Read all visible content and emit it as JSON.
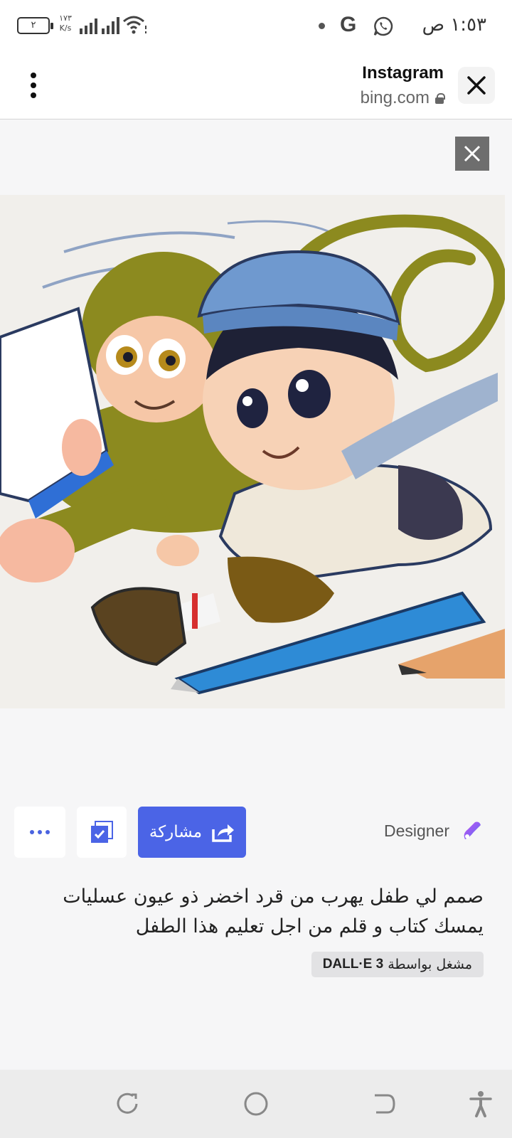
{
  "status_bar": {
    "time": "١:٥٣ ص",
    "battery_text": "٢",
    "net_speed_value": "١٧٣",
    "net_speed_unit": "K/s",
    "icons": [
      "battery-icon",
      "signal-icon",
      "wifi-icon",
      "notification-dot-icon",
      "google-icon",
      "whatsapp-icon"
    ]
  },
  "browser": {
    "title": "Instagram",
    "url": "bing.com",
    "icons": {
      "close": "close-icon",
      "menu": "more-vert-icon",
      "lock": "lock-icon"
    }
  },
  "viewer": {
    "close_icon": "close-icon",
    "image_alt": "monkey-and-child-illustration",
    "actions": {
      "share_label": "مشاركة",
      "share_icon": "share-icon",
      "save_icon": "save-collection-icon",
      "more_icon": "more-horizontal-icon"
    },
    "designer_label": "Designer",
    "designer_icon": "designer-logo-icon",
    "prompt": "صمم لي طفل يهرب من قرد اخضر ذو عيون عسليات يمسك كتاب و قلم من اجل تعليم هذا الطفل",
    "powered_by_label": "مشغل بواسطة",
    "powered_by_model": "DALL·E 3"
  },
  "nav_bar": {
    "icons": [
      "recent-apps-icon",
      "home-icon",
      "back-icon",
      "accessibility-icon"
    ]
  },
  "colors": {
    "accent": "#4b64e6",
    "background": "#f6f6f7",
    "badge_background": "#e2e2e4"
  }
}
